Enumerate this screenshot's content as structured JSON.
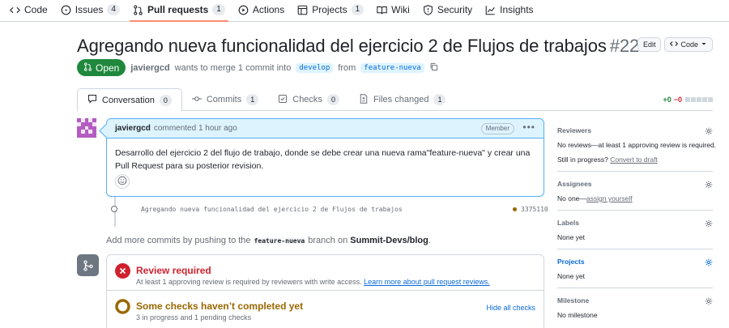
{
  "repo_nav": {
    "items": [
      {
        "label": "Code",
        "icon": "code-icon"
      },
      {
        "label": "Issues",
        "count": "4",
        "icon": "issue-icon"
      },
      {
        "label": "Pull requests",
        "count": "1",
        "icon": "pull-request-icon",
        "active": true
      },
      {
        "label": "Actions",
        "icon": "play-icon"
      },
      {
        "label": "Projects",
        "count": "1",
        "icon": "table-icon"
      },
      {
        "label": "Wiki",
        "icon": "book-icon"
      },
      {
        "label": "Security",
        "icon": "shield-icon"
      },
      {
        "label": "Insights",
        "icon": "graph-icon"
      }
    ]
  },
  "pr": {
    "title": "Agregando nueva funcionalidad del ejercicio 2 de Flujos de trabajos",
    "number": "#22",
    "state": "Open",
    "author": "javiergcd",
    "merge_text": "wants to merge 1 commit into",
    "base_branch": "develop",
    "from_text": "from",
    "head_branch": "feature-nueva",
    "edit_label": "Edit",
    "code_label": "Code"
  },
  "tabs": [
    {
      "label": "Conversation",
      "count": "0",
      "icon": "comment-icon"
    },
    {
      "label": "Commits",
      "count": "1",
      "icon": "commit-icon"
    },
    {
      "label": "Checks",
      "count": "0",
      "icon": "checklist-icon"
    },
    {
      "label": "Files changed",
      "count": "1",
      "icon": "file-diff-icon"
    }
  ],
  "diffstat": {
    "additions": "+0",
    "deletions": "−0"
  },
  "comment": {
    "author": "javiergcd",
    "action": "commented 1 hour ago",
    "role_badge": "Member",
    "body": "Desarrollo del ejercicio 2 del flujo de trabajo, donde se debe crear una nueva rama\"feature-nueva\" y crear una Pull Request para su posterior revision."
  },
  "commit": {
    "message": "Agregando nueva funcionalidad del ejercicio 2 de Flujos de trabajos",
    "sha": "3375110",
    "status_color": "#9a6700"
  },
  "add_more": {
    "prefix": "Add more commits by pushing to the",
    "branch": "feature-nueva",
    "middle": "branch on",
    "repo": "Summit-Devs/blog",
    "suffix": "."
  },
  "merge_box": {
    "review_title": "Review required",
    "review_text": "At least 1 approving review is required by reviewers with write access.",
    "review_link": "Learn more about pull request reviews.",
    "checks_title": "Some checks haven’t completed yet",
    "checks_text": "3 in progress and 1 pending checks",
    "hide_checks": "Hide all checks",
    "review_color": "#cf222e",
    "checks_color": "#9a6700"
  },
  "sidebar": {
    "reviewers": {
      "title": "Reviewers",
      "text": "No reviews—at least 1 approving review is required.",
      "progress_prefix": "Still in progress?",
      "progress_link": "Convert to draft"
    },
    "assignees": {
      "title": "Assignees",
      "prefix": "No one—",
      "link": "assign yourself"
    },
    "labels": {
      "title": "Labels",
      "text": "None yet"
    },
    "projects": {
      "title": "Projects",
      "text": "None yet"
    },
    "milestone": {
      "title": "Milestone",
      "text": "No milestone"
    }
  }
}
